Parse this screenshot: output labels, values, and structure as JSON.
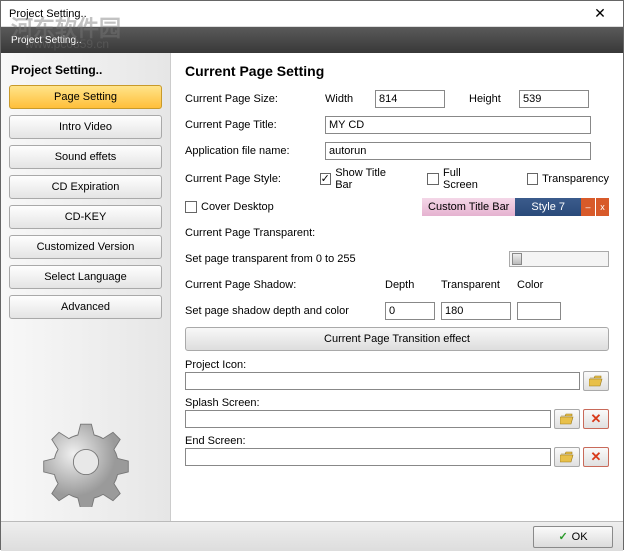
{
  "window": {
    "title": "Project Setting..",
    "ribbon": "Project Setting.."
  },
  "watermark": {
    "main": "河东软件园",
    "sub": "www.pc0359.cn"
  },
  "sidebar": {
    "header": "Project Setting..",
    "items": [
      {
        "label": "Page Setting"
      },
      {
        "label": "Intro Video"
      },
      {
        "label": "Sound effets"
      },
      {
        "label": "CD Expiration"
      },
      {
        "label": "CD-KEY"
      },
      {
        "label": "Customized Version"
      },
      {
        "label": "Select Language"
      },
      {
        "label": "Advanced"
      }
    ]
  },
  "content": {
    "heading": "Current Page Setting",
    "pageSizeLabel": "Current Page Size:",
    "widthLabel": "Width",
    "width": "814",
    "heightLabel": "Height",
    "height": "539",
    "titleLabel": "Current Page Title:",
    "title": "MY CD",
    "appLabel": "Application file name:",
    "app": "autorun",
    "styleLabel": "Current Page Style:",
    "showTitleBar": "Show Title Bar",
    "fullScreen": "Full Screen",
    "transparency": "Transparency",
    "coverDesktop": "Cover Desktop",
    "customTitleBar": "Custom Title Bar",
    "styleName": "Style 7",
    "transparentLabel": "Current Page Transparent:",
    "setTransparent": "Set page transparent from 0 to 255",
    "shadowLabel": "Current Page Shadow:",
    "setShadow": "Set page shadow depth and color",
    "depthLabel": "Depth",
    "depth": "0",
    "transLabel": "Transparent",
    "trans": "180",
    "colorLabel": "Color",
    "transitionBtn": "Current Page Transition effect",
    "iconLabel": "Project Icon:",
    "splashLabel": "Splash Screen:",
    "endLabel": "End Screen:"
  },
  "footer": {
    "ok": "OK"
  }
}
